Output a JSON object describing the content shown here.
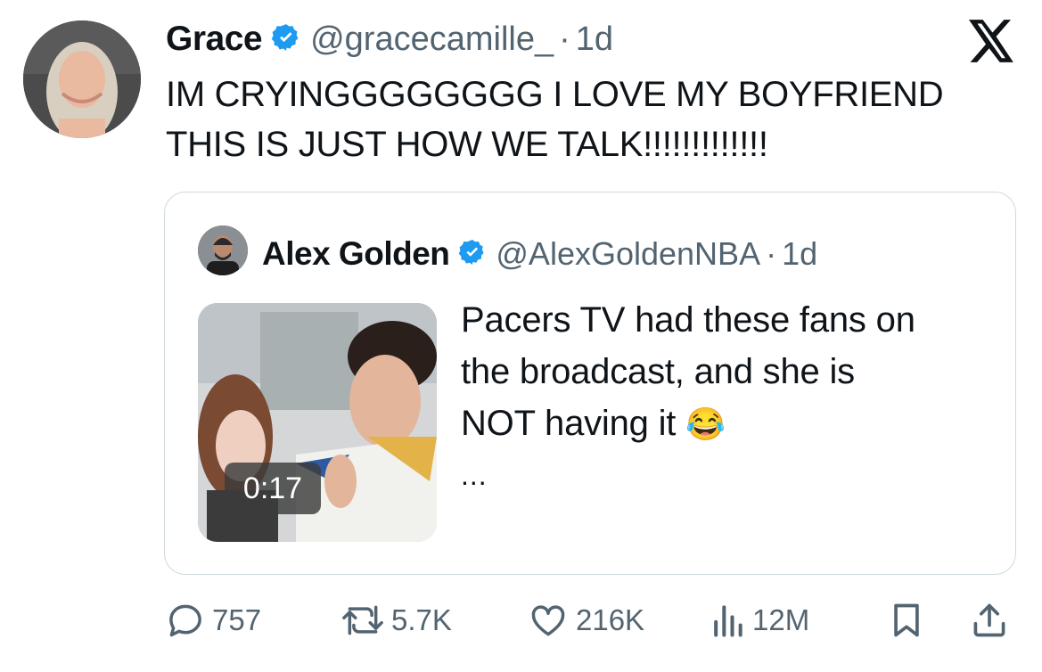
{
  "tweet": {
    "author_name": "Grace",
    "author_handle": "@gracecamille_",
    "age": "1d",
    "separator": "·",
    "text_line1": "IM CRYINGGGGGGGG I LOVE MY BOYFRIEND",
    "text_line2": "THIS IS JUST HOW WE TALK!!!!!!!!!!!!!"
  },
  "quote": {
    "author_name": "Alex Golden",
    "author_handle": "@AlexGoldenNBA",
    "age": "1d",
    "separator": "·",
    "text_line1": "Pacers TV had these fans on",
    "text_line2": "the broadcast, and she is",
    "text_line3": "NOT having it",
    "emoji": "😂",
    "ellipsis": "...",
    "video_duration": "0:17"
  },
  "actions": {
    "replies": "757",
    "reposts": "5.7K",
    "likes": "216K",
    "views": "12M"
  },
  "colors": {
    "text": "#0f1419",
    "secondary": "#536471",
    "verified": "#1d9bf0",
    "border": "#cfd9de"
  },
  "icons": [
    "verified-badge-icon",
    "x-logo-icon",
    "reply-icon",
    "repost-icon",
    "like-icon",
    "views-icon",
    "bookmark-icon",
    "share-icon"
  ]
}
